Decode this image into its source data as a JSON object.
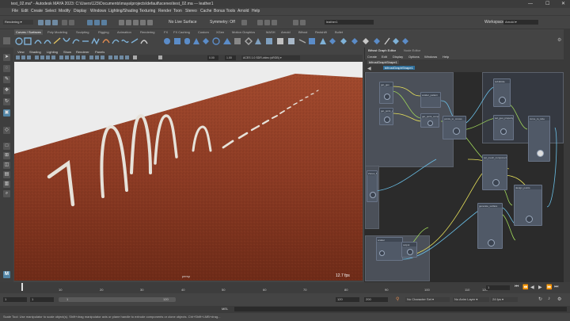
{
  "window": {
    "title": "test_02.ma* - Autodesk MAYA 2023: C:\\Users\\123\\Documents\\maya\\projects\\default\\scenes\\test_02.ma --- leather1"
  },
  "menu": [
    "File",
    "Edit",
    "Create",
    "Select",
    "Modify",
    "Display",
    "Windows",
    "Lighting/Shading",
    "Texturing",
    "Render",
    "Toon",
    "Stereo",
    "Cache",
    "Bonus Tools",
    "Arnold",
    "Help"
  ],
  "status": {
    "mode": "Rendering",
    "live_surface": "No Live Surface",
    "symmetry": "Symmetry: Off",
    "object_name": "leather1",
    "workspace_label": "Workspace:",
    "workspace_value": "Arnold"
  },
  "shelf_tabs": [
    "Curves / Surfaces",
    "Poly Modeling",
    "Sculpting",
    "Rigging",
    "Animation",
    "Rendering",
    "FX",
    "FX Caching",
    "Custom",
    "XGen",
    "Motion Graphics",
    "MASH",
    "Arnold",
    "Bifrost",
    "Redshift",
    "Bullet"
  ],
  "viewport": {
    "menu": [
      "View",
      "Shading",
      "Lighting",
      "Show",
      "Renderer",
      "Panels"
    ],
    "exposure": "0.00",
    "gamma": "1.00",
    "colorspace": "ACES 1.0 SDR-video (sRGB)",
    "camera": "persp",
    "fps": "12.7 fps"
  },
  "bifrost": {
    "title": "Bifrost Graph Editor",
    "node_editor_tab": "Node Editor",
    "menu": [
      "Create",
      "Edit",
      "Display",
      "Options",
      "Windows",
      "Help"
    ],
    "graph_tab": "bifrostGraphShape1",
    "breadcrumb": "bifrostGraphShape1",
    "nodes": [
      "get_geo",
      "get_point_position",
      "scatter_pattern",
      "get_point_component",
      "subdivide",
      "points_to_curves",
      "set_geo_property",
      "curve_to_tube",
      "set_mesh_component",
      "Zones_Manager",
      "Zones",
      "generate_surface",
      "scatter",
      "output",
      "strand_tubes",
      "design_points",
      "remesh",
      "mesh_ops",
      "strand",
      "points_to_curves",
      "output"
    ]
  },
  "timeline": {
    "ticks": [
      "10",
      "20",
      "30",
      "40",
      "50",
      "60",
      "70",
      "80",
      "90",
      "100",
      "110",
      "120"
    ],
    "current_frame": "1"
  },
  "range": {
    "start": "1",
    "inner_start": "1",
    "inner_end": "120",
    "end": "120",
    "max": "200",
    "character_set": "No Character Set",
    "anim_layer": "No Anim Layer",
    "fps": "24 fps"
  },
  "command": {
    "lang": "MEL"
  },
  "help": {
    "text": "Scale Tool: Use manipulator to scale object(s). Shift+drag manipulator axis or plane handle to extrude components or clone objects. Ctrl+Shift+LMB+drag..."
  },
  "colors": {
    "floor": "#8c3b24",
    "sky": "#ececec",
    "graph_bg": "#2b2b2b",
    "accent": "#5285a6"
  }
}
